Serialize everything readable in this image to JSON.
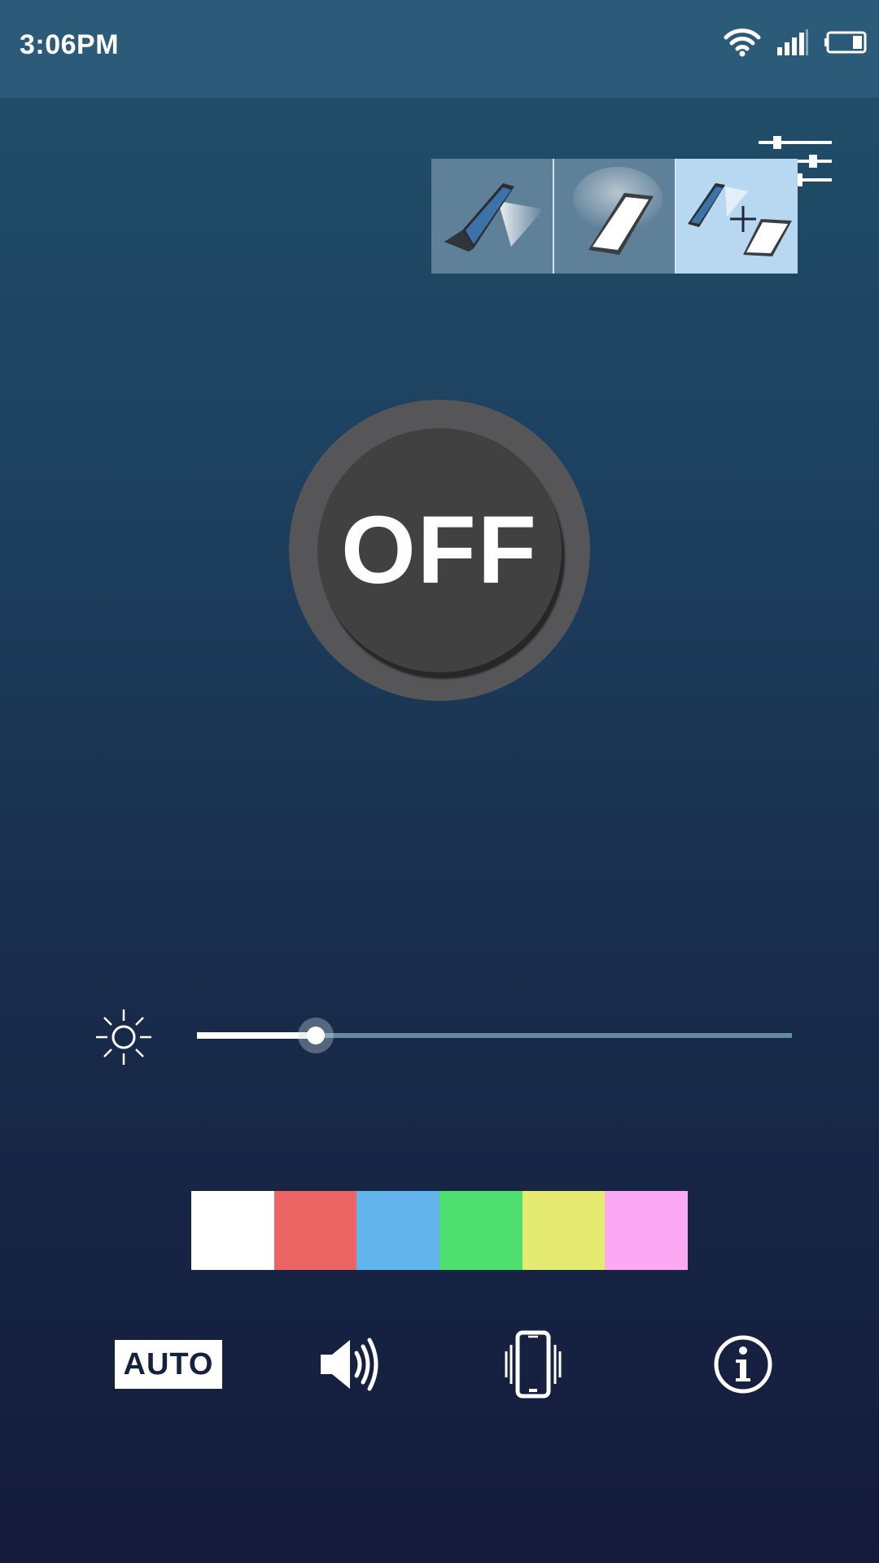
{
  "status_bar": {
    "time": "3:06PM",
    "icons": [
      "wifi-icon",
      "cellular-signal-icon",
      "battery-icon"
    ]
  },
  "settings": {
    "icon": "sliders-icon"
  },
  "mode_selector": {
    "modes": [
      {
        "name": "camera-flash-mode",
        "icon": "phone-flash-icon",
        "active": false
      },
      {
        "name": "screen-light-mode",
        "icon": "phone-screen-light-icon",
        "active": false
      },
      {
        "name": "combined-mode",
        "icon": "phone-flash-plus-screen-icon",
        "active": true
      }
    ]
  },
  "power": {
    "label": "OFF"
  },
  "brightness": {
    "icon": "sun-icon",
    "value": 0.2
  },
  "colors": {
    "swatches": [
      "#ffffff",
      "#ec6464",
      "#62b5ec",
      "#4edf70",
      "#e3ea6f",
      "#fda8f2"
    ],
    "accent": "#2b5b78",
    "mode_active_bg": "#b7d8f0",
    "mode_bg": "#5f8099"
  },
  "toolbar": {
    "auto_label": "AUTO",
    "sound_icon": "speaker-icon",
    "vibrate_icon": "vibrate-icon",
    "info_icon": "info-icon"
  }
}
